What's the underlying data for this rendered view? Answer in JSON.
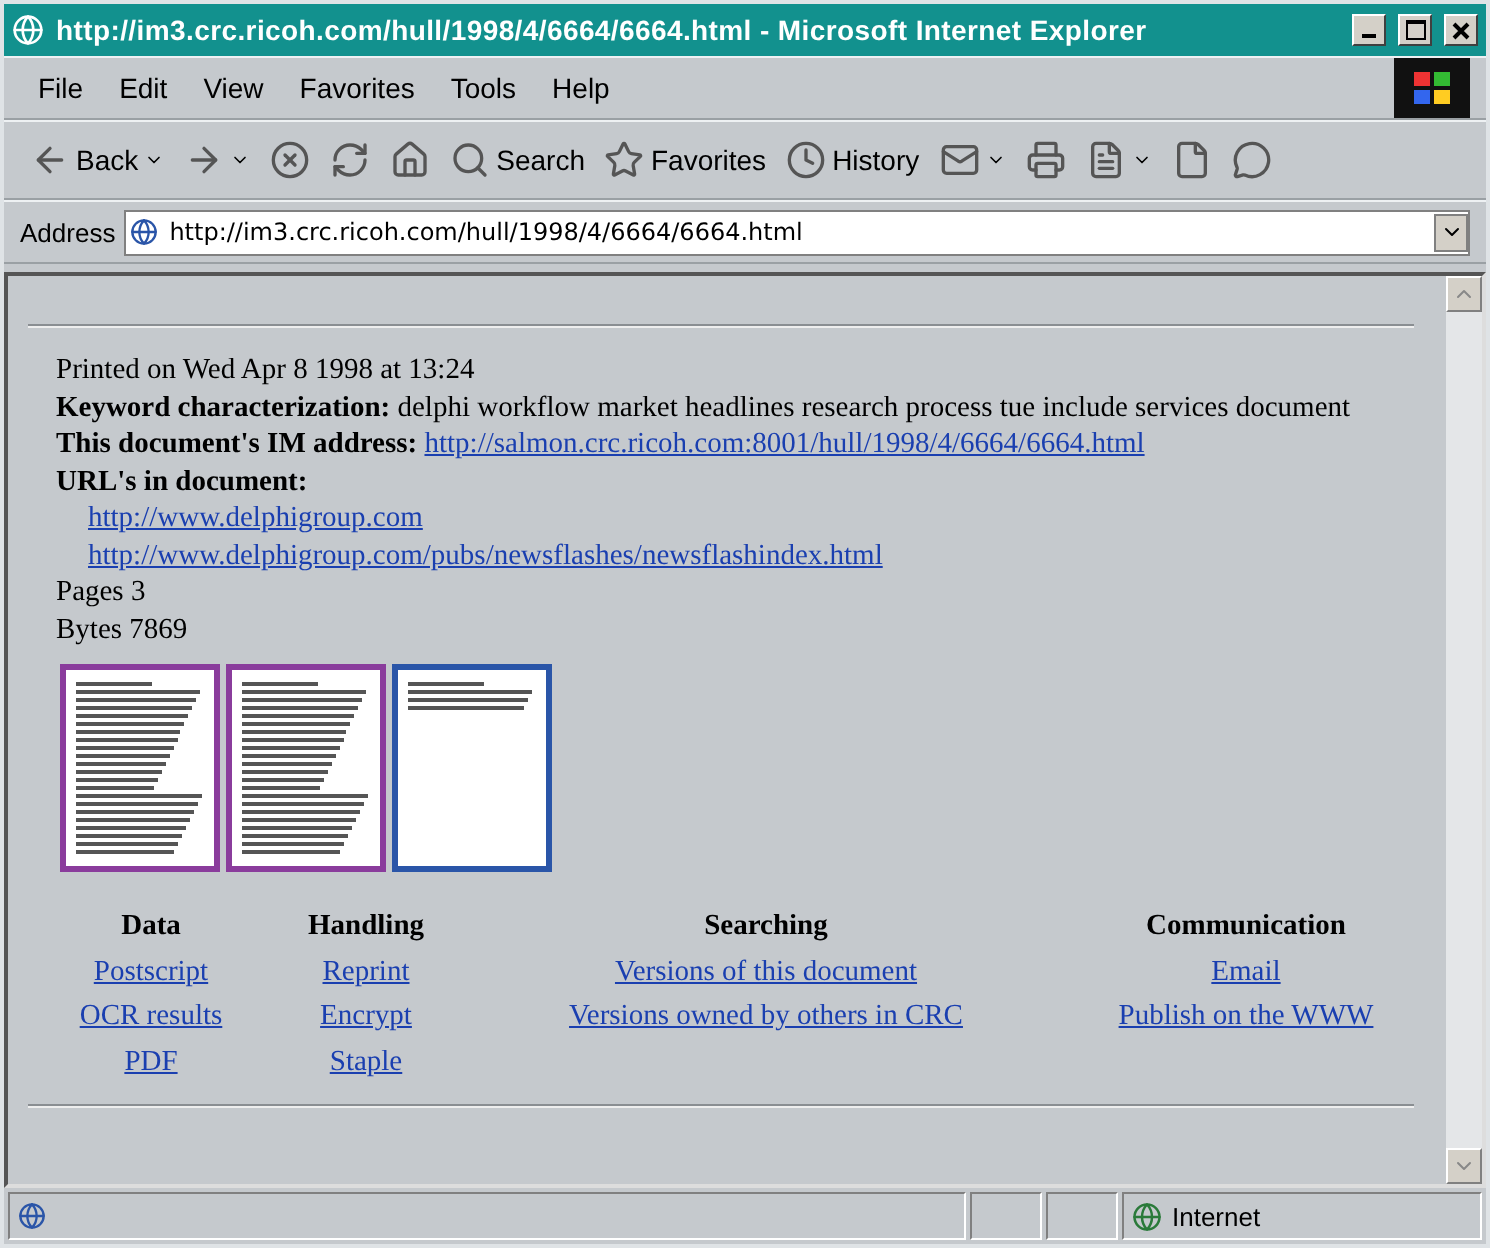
{
  "window": {
    "title": "http://im3.crc.ricoh.com/hull/1998/4/6664/6664.html - Microsoft Internet Explorer"
  },
  "menu": [
    "File",
    "Edit",
    "View",
    "Favorites",
    "Tools",
    "Help"
  ],
  "toolbar": [
    {
      "kind": "back",
      "label": "Back"
    },
    {
      "kind": "forward"
    },
    {
      "kind": "stop"
    },
    {
      "kind": "refresh"
    },
    {
      "kind": "home"
    },
    {
      "kind": "search",
      "label": "Search"
    },
    {
      "kind": "favorites",
      "label": "Favorites"
    },
    {
      "kind": "history",
      "label": "History"
    },
    {
      "kind": "mail"
    },
    {
      "kind": "print"
    },
    {
      "kind": "edit"
    },
    {
      "kind": "page"
    },
    {
      "kind": "discuss"
    }
  ],
  "address": {
    "label": "Address",
    "value": "http://im3.crc.ricoh.com/hull/1998/4/6664/6664.html"
  },
  "page": {
    "printed": "Printed on Wed Apr 8 1998 at 13:24",
    "keyword": {
      "label": "Keyword characterization:",
      "value": "delphi workflow market headlines research process tue include services document"
    },
    "im_address": {
      "label": "This document's IM address:",
      "link": "http://salmon.crc.ricoh.com:8001/hull/1998/4/6664/6664.html"
    },
    "urls": {
      "label": "URL's in document:",
      "links": [
        "http://www.delphigroup.com",
        "http://www.delphigroup.com/pubs/newsflashes/newsflashindex.html"
      ]
    },
    "pages": "Pages 3",
    "bytes": "Bytes 7869",
    "thumbnails": [
      {
        "color": "#8a3c9c",
        "kind": "dense"
      },
      {
        "color": "#8a3c9c",
        "kind": "dense"
      },
      {
        "color": "#2a55a8",
        "kind": "short"
      }
    ],
    "columns": [
      {
        "heading": "Data",
        "links": [
          "Postscript",
          "OCR results",
          "PDF"
        ]
      },
      {
        "heading": "Handling",
        "links": [
          "Reprint",
          "Encrypt",
          "Staple"
        ]
      },
      {
        "heading": "Searching",
        "links": [
          "Versions of this document",
          "Versions owned by others in CRC"
        ]
      },
      {
        "heading": "Communication",
        "links": [
          "Email",
          "Publish on the WWW"
        ]
      }
    ]
  },
  "status_bar": {
    "zone": "Internet"
  }
}
